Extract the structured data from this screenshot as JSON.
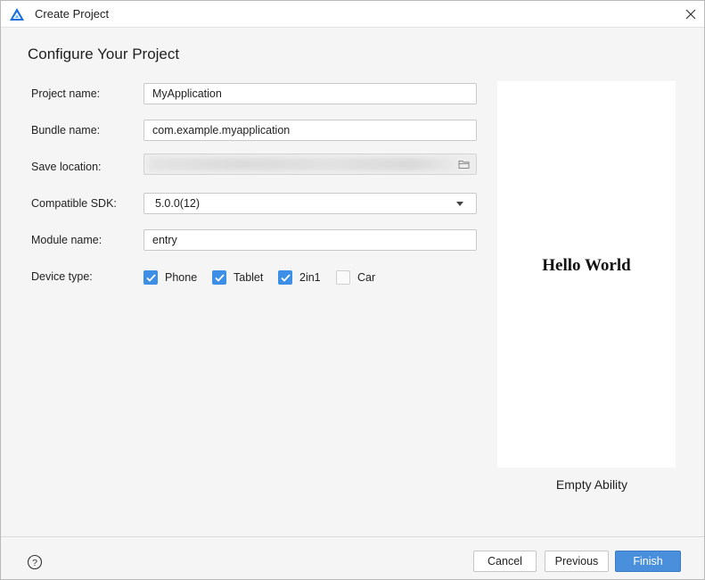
{
  "window": {
    "title": "Create Project",
    "logo_icon": "deveco-logo-icon",
    "close_icon": "close-icon"
  },
  "heading": "Configure Your Project",
  "form": {
    "project_name": {
      "label": "Project name:",
      "value": "MyApplication"
    },
    "bundle_name": {
      "label": "Bundle name:",
      "value": "com.example.myapplication"
    },
    "save_location": {
      "label": "Save location:",
      "value": "",
      "browse_icon": "folder-icon"
    },
    "compatible_sdk": {
      "label": "Compatible SDK:",
      "value": "5.0.0(12)"
    },
    "module_name": {
      "label": "Module name:",
      "value": "entry"
    },
    "device_type": {
      "label": "Device type:",
      "options": [
        {
          "label": "Phone",
          "checked": true
        },
        {
          "label": "Tablet",
          "checked": true
        },
        {
          "label": "2in1",
          "checked": true
        },
        {
          "label": "Car",
          "checked": false
        }
      ]
    }
  },
  "preview": {
    "hello_text": "Hello World",
    "template_name": "Empty Ability"
  },
  "footer": {
    "help_icon": "help-icon",
    "cancel": "Cancel",
    "previous": "Previous",
    "finish": "Finish"
  },
  "colors": {
    "accent": "#3c8ee6",
    "primary_button": "#4a8fdb",
    "logo_blue": "#1a6fe0"
  }
}
